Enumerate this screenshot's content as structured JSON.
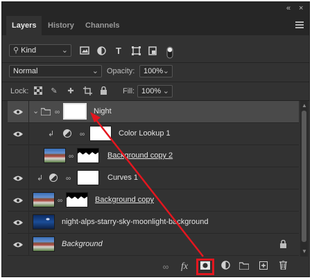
{
  "panel": {
    "title_controls": {
      "collapse": "«",
      "close": "×"
    },
    "tabs": [
      {
        "label": "Layers",
        "active": true
      },
      {
        "label": "History",
        "active": false
      },
      {
        "label": "Channels",
        "active": false
      }
    ]
  },
  "filter": {
    "kind_label": "Kind",
    "icons": [
      "image-filter-icon",
      "adjustment-filter-icon",
      "type-filter-icon",
      "shape-filter-icon",
      "smart-object-filter-icon",
      "filter-toggle"
    ]
  },
  "blend": {
    "mode": "Normal",
    "opacity_label": "Opacity:",
    "opacity_value": "100%"
  },
  "lock": {
    "label": "Lock:",
    "fill_label": "Fill:",
    "fill_value": "100%"
  },
  "layers": [
    {
      "name": "Night",
      "type": "group",
      "selected": true
    },
    {
      "name": "Color Lookup 1",
      "type": "adjustment"
    },
    {
      "name": "Background copy 2",
      "type": "photo-masked"
    },
    {
      "name": "Curves 1",
      "type": "adjustment"
    },
    {
      "name": "Background copy",
      "type": "photo-masked"
    },
    {
      "name": "night-alps-starry-sky-moonlight-background",
      "type": "photo"
    },
    {
      "name": "Background",
      "type": "photo-locked"
    }
  ],
  "toolbar": {
    "link_icon": "link-icon",
    "fx_label": "fx",
    "mask_icon": "add-mask-icon",
    "adjustment_icon": "adjustment-layer-icon",
    "group_icon": "folder-icon",
    "new_layer_icon": "new-layer-icon",
    "delete_icon": "trash-icon"
  },
  "annotation_color": "#e3161f"
}
